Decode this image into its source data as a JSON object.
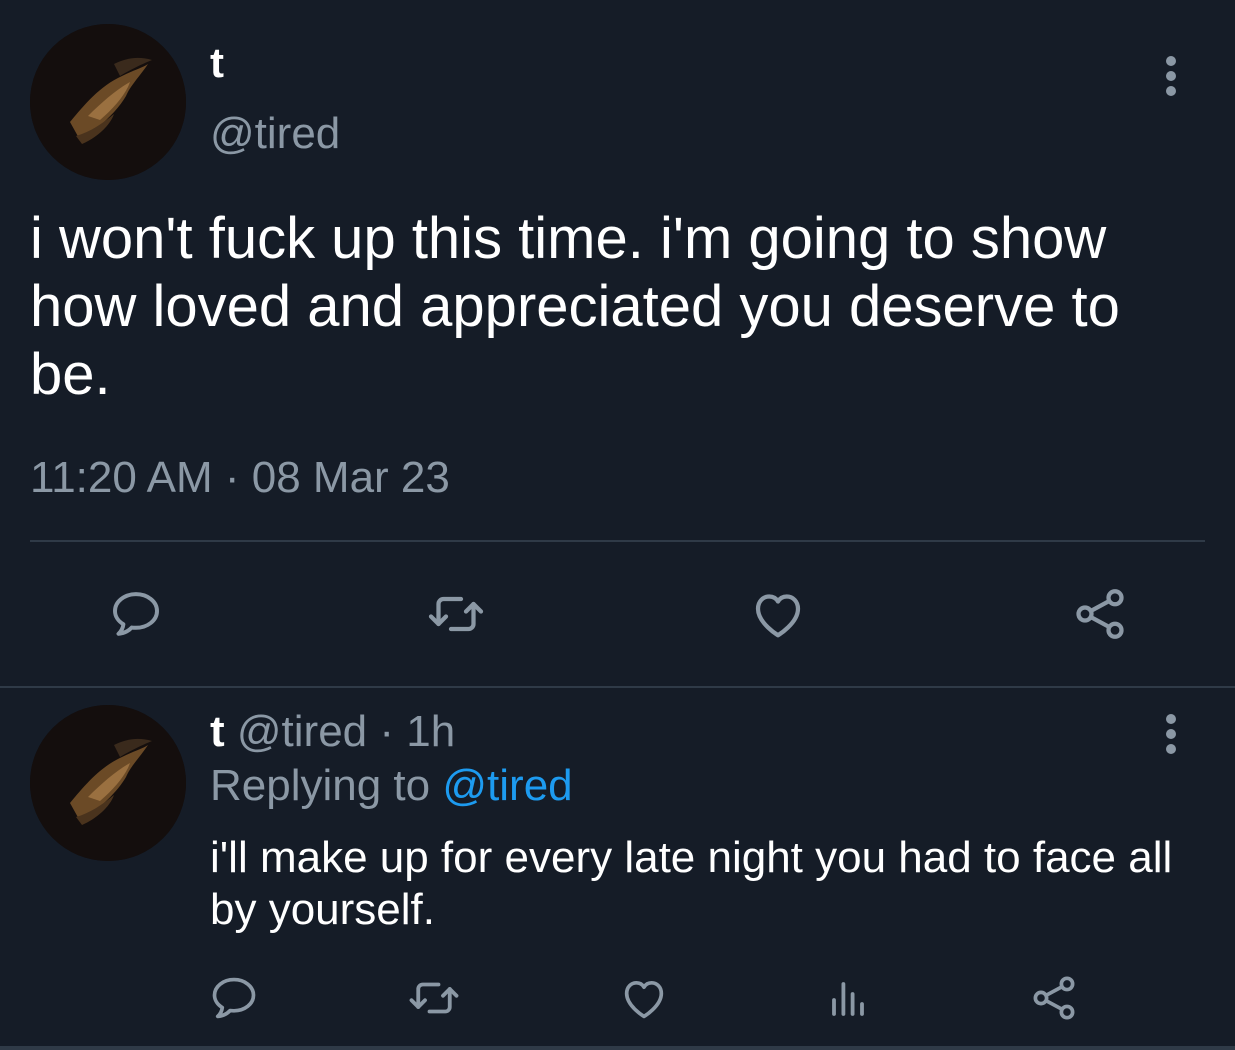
{
  "colors": {
    "background": "#151c27",
    "text_primary": "#ffffff",
    "text_secondary": "#8b98a5",
    "link": "#1d9bf0",
    "divider": "#2f3a47"
  },
  "main_tweet": {
    "display_name": "t",
    "handle": "@tired",
    "text": "i won't fuck up this time. i'm going to show how loved and appreciated you deserve to be.",
    "time": "11:20 AM",
    "separator": "·",
    "date": "08 Mar 23",
    "actions": [
      {
        "icon": "reply-icon"
      },
      {
        "icon": "retweet-icon"
      },
      {
        "icon": "like-icon"
      },
      {
        "icon": "share-icon"
      }
    ],
    "more_icon": "more-options-icon"
  },
  "reply_tweet": {
    "display_name": "t",
    "handle": "@tired",
    "separator": "·",
    "time_ago": "1h",
    "replying_label": "Replying to",
    "replying_to": "@tired",
    "text": "i'll make up for every late night you had to face all by yourself.",
    "actions": [
      {
        "icon": "reply-icon"
      },
      {
        "icon": "retweet-icon"
      },
      {
        "icon": "like-icon"
      },
      {
        "icon": "views-icon"
      },
      {
        "icon": "share-icon"
      }
    ],
    "more_icon": "more-options-icon"
  }
}
